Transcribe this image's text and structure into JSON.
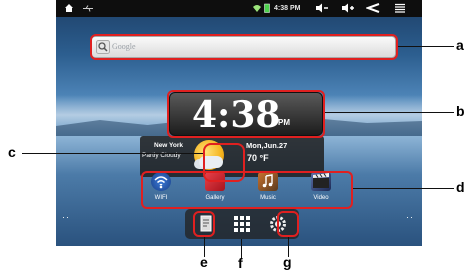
{
  "status_bar": {
    "time": "4:38 PM"
  },
  "search": {
    "placeholder": "Google"
  },
  "clock": {
    "time": "4:38",
    "ampm": "PM"
  },
  "weather": {
    "city": "New York",
    "condition": "Partly Cloudy",
    "date": "Mon,Jun.27",
    "temperature": "70 °F"
  },
  "apps": [
    {
      "label": "WIFI",
      "icon": "wifi-icon"
    },
    {
      "label": "Gallery",
      "icon": "gallery-icon"
    },
    {
      "label": "Music",
      "icon": "music-icon"
    },
    {
      "label": "Video",
      "icon": "video-icon"
    }
  ],
  "tray": [
    "file-manager-icon",
    "app-drawer-icon",
    "settings-icon"
  ],
  "callouts": {
    "a": "a",
    "b": "b",
    "c": "c",
    "d": "d",
    "e": "e",
    "f": "f",
    "g": "g"
  },
  "colors": {
    "highlight": "#e02020",
    "status_bar": "#0e0e0e"
  }
}
